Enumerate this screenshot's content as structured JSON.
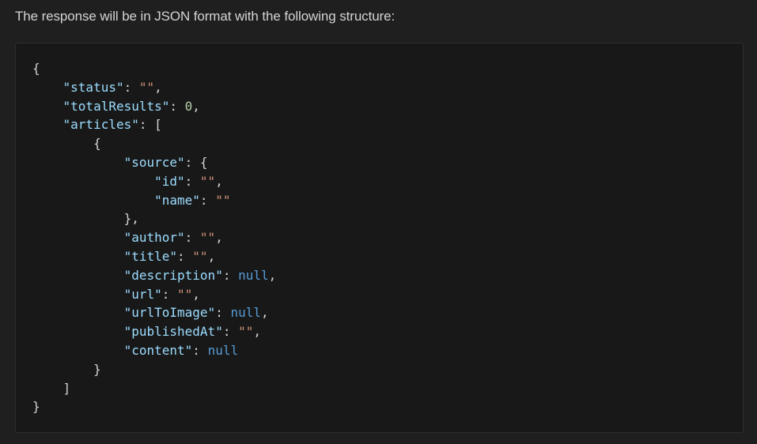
{
  "intro_text": "The response will be in JSON format with the following structure:",
  "code_lines": [
    [
      {
        "t": "{",
        "c": "punc"
      }
    ],
    [
      {
        "t": "    "
      },
      {
        "t": "\"status\"",
        "c": "key"
      },
      {
        "t": ": ",
        "c": "punc"
      },
      {
        "t": "\"\"",
        "c": "str"
      },
      {
        "t": ",",
        "c": "punc"
      }
    ],
    [
      {
        "t": "    "
      },
      {
        "t": "\"totalResults\"",
        "c": "key"
      },
      {
        "t": ": ",
        "c": "punc"
      },
      {
        "t": "0",
        "c": "num"
      },
      {
        "t": ",",
        "c": "punc"
      }
    ],
    [
      {
        "t": "    "
      },
      {
        "t": "\"articles\"",
        "c": "key"
      },
      {
        "t": ": [",
        "c": "punc"
      }
    ],
    [
      {
        "t": "        "
      },
      {
        "t": "{",
        "c": "punc"
      }
    ],
    [
      {
        "t": "            "
      },
      {
        "t": "\"source\"",
        "c": "key"
      },
      {
        "t": ": {",
        "c": "punc"
      }
    ],
    [
      {
        "t": "                "
      },
      {
        "t": "\"id\"",
        "c": "key"
      },
      {
        "t": ": ",
        "c": "punc"
      },
      {
        "t": "\"\"",
        "c": "str"
      },
      {
        "t": ",",
        "c": "punc"
      }
    ],
    [
      {
        "t": "                "
      },
      {
        "t": "\"name\"",
        "c": "key"
      },
      {
        "t": ": ",
        "c": "punc"
      },
      {
        "t": "\"\"",
        "c": "str"
      }
    ],
    [
      {
        "t": "            "
      },
      {
        "t": "},",
        "c": "punc"
      }
    ],
    [
      {
        "t": "            "
      },
      {
        "t": "\"author\"",
        "c": "key"
      },
      {
        "t": ": ",
        "c": "punc"
      },
      {
        "t": "\"\"",
        "c": "str"
      },
      {
        "t": ",",
        "c": "punc"
      }
    ],
    [
      {
        "t": "            "
      },
      {
        "t": "\"title\"",
        "c": "key"
      },
      {
        "t": ": ",
        "c": "punc"
      },
      {
        "t": "\"\"",
        "c": "str"
      },
      {
        "t": ",",
        "c": "punc"
      }
    ],
    [
      {
        "t": "            "
      },
      {
        "t": "\"description\"",
        "c": "key"
      },
      {
        "t": ": ",
        "c": "punc"
      },
      {
        "t": "null",
        "c": "kw"
      },
      {
        "t": ",",
        "c": "punc"
      }
    ],
    [
      {
        "t": "            "
      },
      {
        "t": "\"url\"",
        "c": "key"
      },
      {
        "t": ": ",
        "c": "punc"
      },
      {
        "t": "\"\"",
        "c": "str"
      },
      {
        "t": ",",
        "c": "punc"
      }
    ],
    [
      {
        "t": "            "
      },
      {
        "t": "\"urlToImage\"",
        "c": "key"
      },
      {
        "t": ": ",
        "c": "punc"
      },
      {
        "t": "null",
        "c": "kw"
      },
      {
        "t": ",",
        "c": "punc"
      }
    ],
    [
      {
        "t": "            "
      },
      {
        "t": "\"publishedAt\"",
        "c": "key"
      },
      {
        "t": ": ",
        "c": "punc"
      },
      {
        "t": "\"\"",
        "c": "str"
      },
      {
        "t": ",",
        "c": "punc"
      }
    ],
    [
      {
        "t": "            "
      },
      {
        "t": "\"content\"",
        "c": "key"
      },
      {
        "t": ": ",
        "c": "punc"
      },
      {
        "t": "null",
        "c": "kw"
      }
    ],
    [
      {
        "t": "        "
      },
      {
        "t": "}",
        "c": "punc"
      }
    ],
    [
      {
        "t": "    "
      },
      {
        "t": "]",
        "c": "punc"
      }
    ],
    [
      {
        "t": "}",
        "c": "punc"
      }
    ]
  ],
  "colors": {
    "background": "#1f1f1f",
    "code_background": "#181818",
    "key": "#9cdcfe",
    "string": "#ce9178",
    "number": "#b5cea8",
    "keyword": "#569cd6",
    "punctuation": "#d4d4d4"
  }
}
